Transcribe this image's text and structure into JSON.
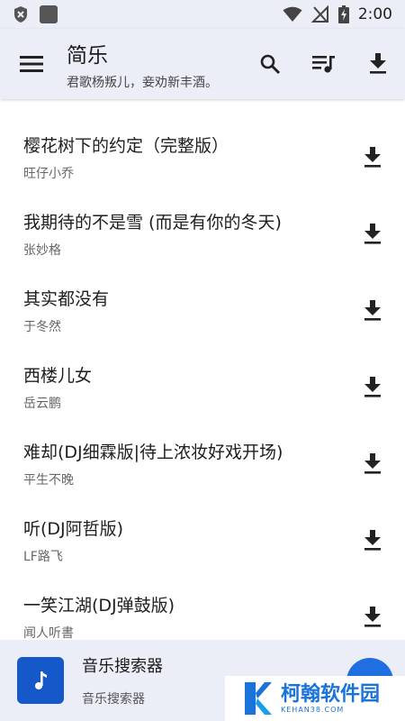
{
  "status_bar": {
    "time": "2:00",
    "icons": [
      "shield-x-icon",
      "app-square-icon",
      "wifi-icon",
      "no-signal-icon",
      "battery-charging-icon"
    ]
  },
  "app_bar": {
    "title": "简乐",
    "subtitle": "君歌杨叛儿，妾劝新丰酒。",
    "icons": [
      "menu-icon",
      "search-icon",
      "playlist-icon",
      "download-icon"
    ]
  },
  "song_list": {
    "partial_top_artist": "~~~",
    "items": [
      {
        "title": "樱花树下的约定（完整版）",
        "artist": "旺仔小乔"
      },
      {
        "title": "我期待的不是雪 (而是有你的冬天)",
        "artist": "张妙格"
      },
      {
        "title": "其实都没有",
        "artist": "于冬然"
      },
      {
        "title": "西楼儿女",
        "artist": "岳云鹏"
      },
      {
        "title": "难却(DJ细霖版|待上浓妆好戏开场)",
        "artist": "平生不晚"
      },
      {
        "title": "听(DJ阿哲版)",
        "artist": "LF路飞"
      },
      {
        "title": "一笑江湖(DJ弹鼓版)",
        "artist": "闻人听書"
      }
    ]
  },
  "player": {
    "title": "音乐搜索器",
    "subtitle": "音乐搜索器"
  },
  "watermark": {
    "name": "柯翰软件园",
    "url": "KEHAN38.COM"
  },
  "colors": {
    "bar_background": "#eceef7",
    "accent": "#1f6fe0",
    "cover": "#1558c9"
  }
}
